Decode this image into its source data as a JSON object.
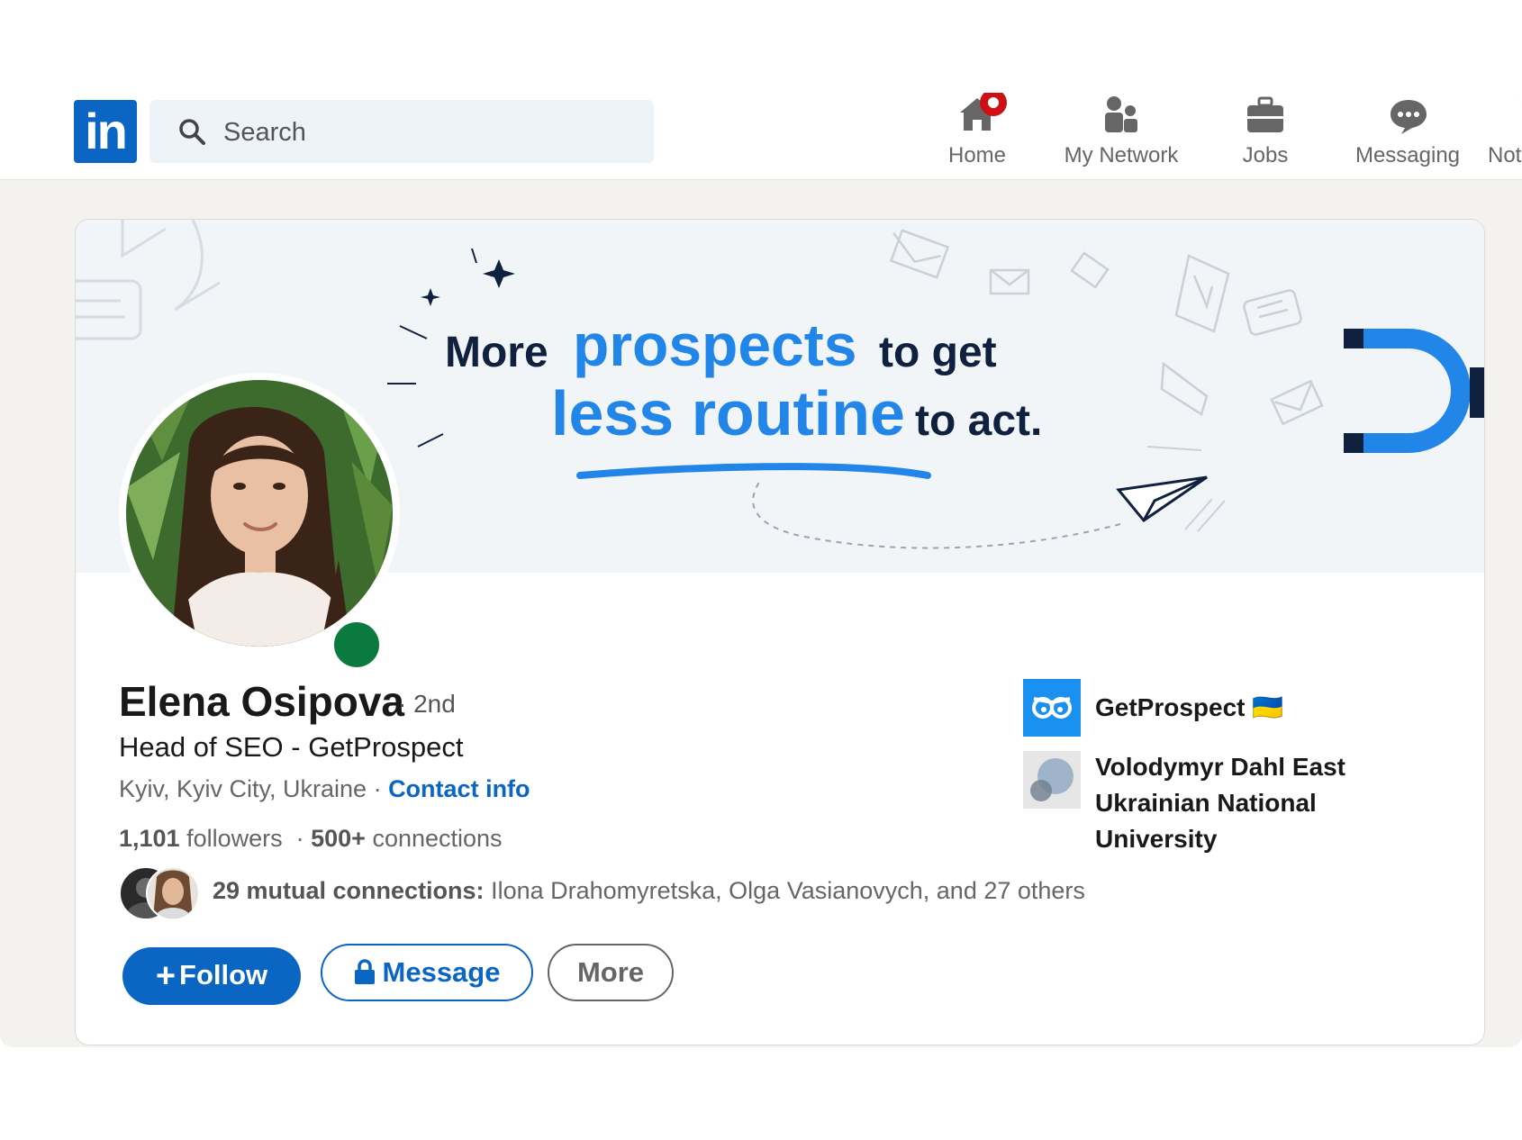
{
  "nav": {
    "logo_text": "in",
    "search_placeholder": "Search",
    "items": [
      {
        "label": "Home",
        "icon": "home-icon",
        "has_badge": true
      },
      {
        "label": "My Network",
        "icon": "network-icon"
      },
      {
        "label": "Jobs",
        "icon": "briefcase-icon"
      },
      {
        "label": "Messaging",
        "icon": "messaging-icon"
      },
      {
        "label": "Not",
        "icon": "notifications-icon"
      }
    ]
  },
  "banner": {
    "line1_a": "More",
    "line1_b": "prospects",
    "line1_c": "to get",
    "line2_a": "less routine",
    "line2_b": "to act."
  },
  "profile": {
    "name": "Elena Osipova",
    "degree": "· 2nd",
    "headline": "Head of SEO - GetProspect",
    "location": "Kyiv, Kyiv City, Ukraine",
    "location_sep": " · ",
    "contact_info": "Contact info",
    "followers_count": "1,101",
    "followers_label": " followers",
    "stats_sep": "  · ",
    "connections_count": "500+",
    "connections_label": " connections",
    "mutual_count": "29 mutual connections:",
    "mutual_names": " Ilona Drahomyretska, Olga Vasianovych, and 27 others",
    "online": true
  },
  "actions": {
    "follow": "Follow",
    "message": "Message",
    "more": "More"
  },
  "sidebar": {
    "company": "GetProspect 🇺🇦",
    "education": "Volodymyr Dahl East Ukrainian National University"
  },
  "colors": {
    "brand": "#0a66c2",
    "online": "#0b7a3e",
    "badge": "#cc1016",
    "banner_blue": "#2285e8",
    "banner_dark": "#10213f"
  }
}
